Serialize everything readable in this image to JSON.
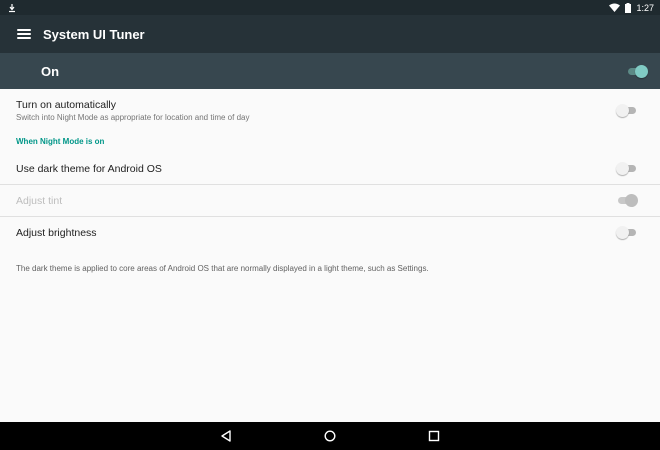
{
  "status_bar": {
    "time": "1:27",
    "icons": [
      "download-notification-icon",
      "wifi-icon",
      "battery-icon"
    ]
  },
  "app_bar": {
    "title": "System UI Tuner",
    "menu_icon": "hamburger-menu-icon"
  },
  "master_switch": {
    "label": "On",
    "checked": true
  },
  "settings": {
    "turn_on_auto": {
      "title": "Turn on automatically",
      "summary": "Switch into Night Mode as appropriate for location and time of day",
      "checked": false
    },
    "section_header": "When Night Mode is on",
    "dark_theme": {
      "title": "Use dark theme for Android OS",
      "checked": false
    },
    "adjust_tint": {
      "title": "Adjust tint",
      "checked": true,
      "enabled": false
    },
    "adjust_brightness": {
      "title": "Adjust brightness",
      "checked": false
    },
    "footer": "The dark theme is applied to core areas of Android OS that are normally displayed in a light theme, such as Settings."
  },
  "nav_bar": {
    "icons": [
      "back-icon",
      "home-icon",
      "recents-icon"
    ]
  },
  "colors": {
    "accent": "#80cbc4",
    "section_header": "#009688",
    "app_bar": "#263238",
    "master_bar": "#37474f"
  }
}
